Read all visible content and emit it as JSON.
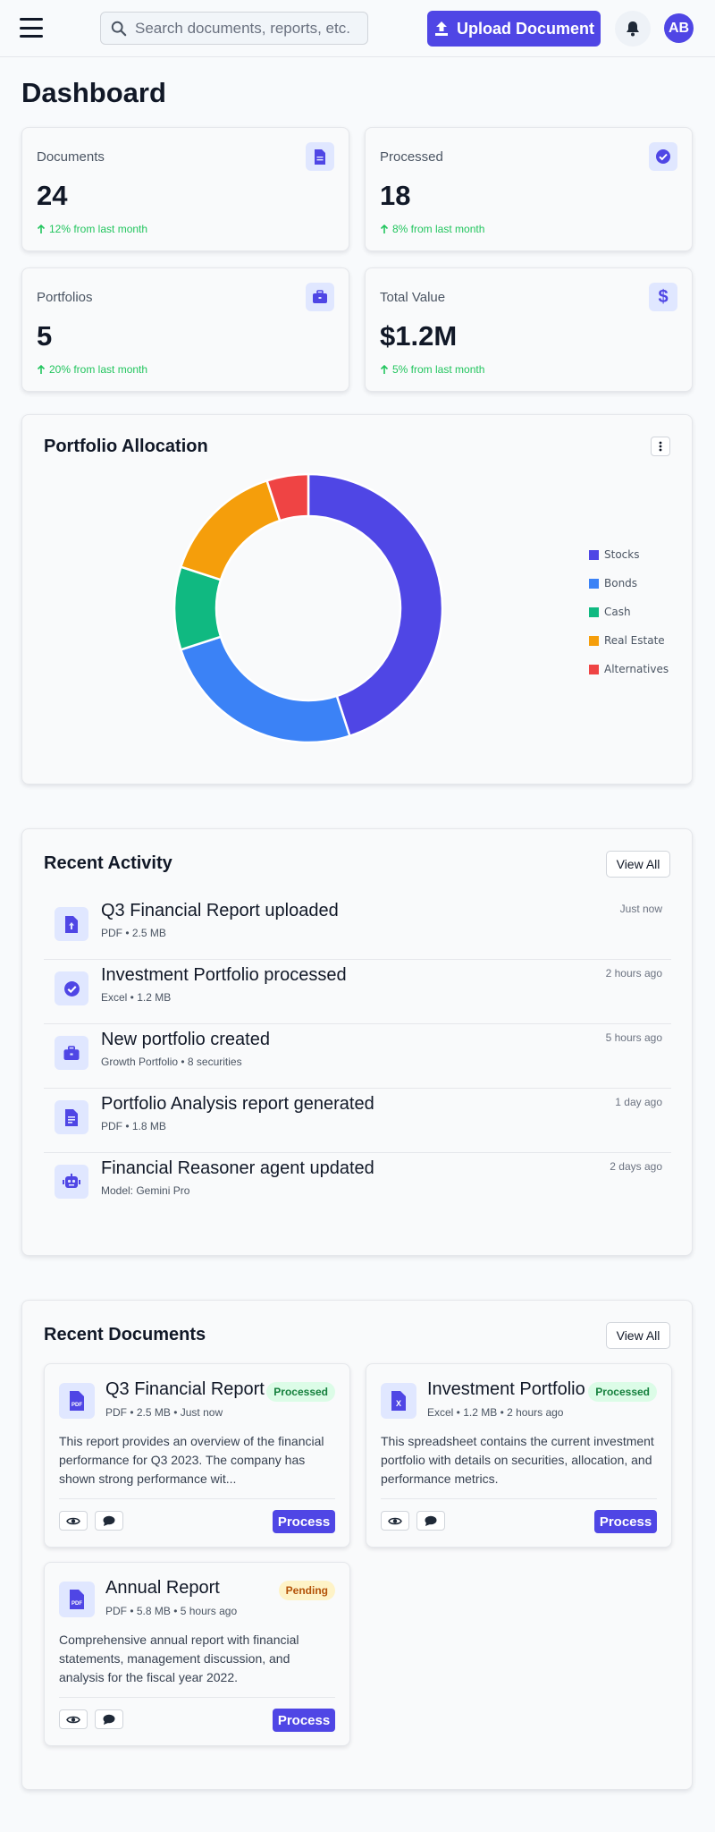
{
  "header": {
    "search_placeholder": "Search documents, reports, etc.",
    "upload_label": "Upload Document",
    "avatar_initials": "AB"
  },
  "page": {
    "title": "Dashboard"
  },
  "stats": [
    {
      "label": "Documents",
      "value": "24",
      "delta": "12% from last month",
      "icon": "document-icon"
    },
    {
      "label": "Processed",
      "value": "18",
      "delta": "8% from last month",
      "icon": "check-circle-icon"
    },
    {
      "label": "Portfolios",
      "value": "5",
      "delta": "20% from last month",
      "icon": "briefcase-icon"
    },
    {
      "label": "Total Value",
      "value": "$1.2M",
      "delta": "5% from last month",
      "icon": "dollar-icon"
    }
  ],
  "allocation": {
    "title": "Portfolio Allocation",
    "chart_data": {
      "type": "pie",
      "donut": true,
      "categories": [
        "Stocks",
        "Bonds",
        "Cash",
        "Real Estate",
        "Alternatives"
      ],
      "values": [
        45,
        25,
        10,
        15,
        5
      ],
      "colors": [
        "#4f46e5",
        "#3b82f6",
        "#10b981",
        "#f59e0b",
        "#ef4444"
      ],
      "legend_position": "right"
    }
  },
  "activity": {
    "title": "Recent Activity",
    "view_all": "View All",
    "items": [
      {
        "title": "Q3 Financial Report uploaded",
        "meta": "PDF • 2.5 MB",
        "time": "Just now",
        "icon": "file-upload-icon"
      },
      {
        "title": "Investment Portfolio processed",
        "meta": "Excel • 1.2 MB",
        "time": "2 hours ago",
        "icon": "check-circle-icon"
      },
      {
        "title": "New portfolio created",
        "meta": "Growth Portfolio • 8 securities",
        "time": "5 hours ago",
        "icon": "briefcase-icon"
      },
      {
        "title": "Portfolio Analysis report generated",
        "meta": "PDF • 1.8 MB",
        "time": "1 day ago",
        "icon": "report-icon"
      },
      {
        "title": "Financial Reasoner agent updated",
        "meta": "Model: Gemini Pro",
        "time": "2 days ago",
        "icon": "robot-icon"
      }
    ]
  },
  "documents": {
    "title": "Recent Documents",
    "view_all": "View All",
    "process_label": "Process",
    "items": [
      {
        "title": "Q3 Financial Report",
        "meta": "PDF • 2.5 MB • Just now",
        "status": "Processed",
        "type_icon": "pdf-file-icon",
        "file_tag": "PDF",
        "description": "This report provides an overview of the financial performance for Q3 2023. The company has shown strong performance wit..."
      },
      {
        "title": "Investment Portfolio",
        "meta": "Excel • 1.2 MB • 2 hours ago",
        "status": "Processed",
        "type_icon": "excel-file-icon",
        "file_tag": "X",
        "description": "This spreadsheet contains the current investment portfolio with details on securities, allocation, and performance metrics."
      },
      {
        "title": "Annual Report",
        "meta": "PDF • 5.8 MB • 5 hours ago",
        "status": "Pending",
        "type_icon": "pdf-file-icon",
        "file_tag": "PDF",
        "description": "Comprehensive annual report with financial statements, management discussion, and analysis for the fiscal year 2022."
      }
    ]
  }
}
